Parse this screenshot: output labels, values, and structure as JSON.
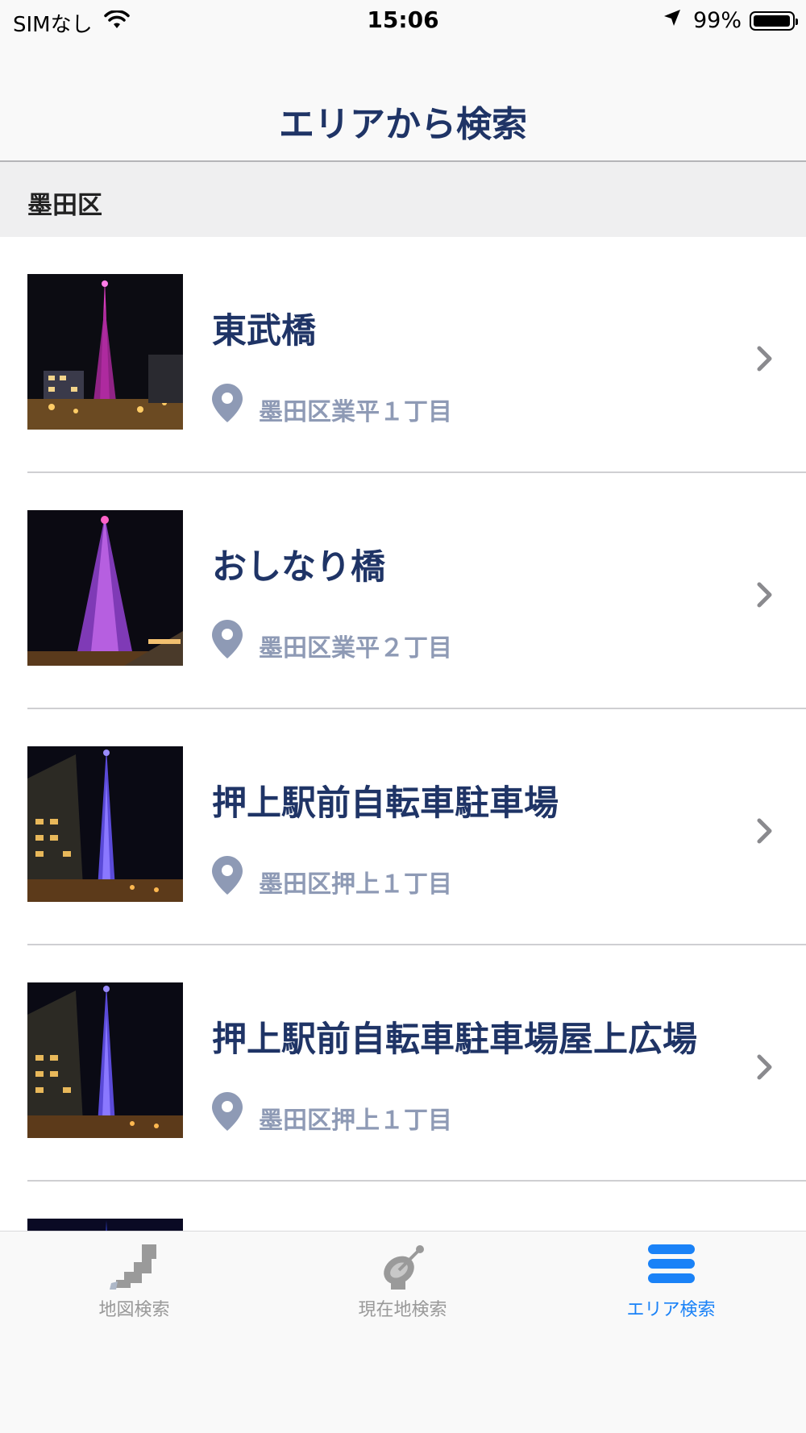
{
  "status": {
    "carrier": "SIMなし",
    "time": "15:06",
    "battery": "99%"
  },
  "nav": {
    "title": "エリアから検索"
  },
  "section": {
    "title": "墨田区"
  },
  "list": {
    "items": [
      {
        "name": "東武橋",
        "address": "墨田区業平１丁目"
      },
      {
        "name": "おしなり橋",
        "address": "墨田区業平２丁目"
      },
      {
        "name": "押上駅前自転車駐車場",
        "address": "墨田区押上１丁目"
      },
      {
        "name": "押上駅前自転車駐車場屋上広場",
        "address": "墨田区押上１丁目"
      }
    ]
  },
  "tabs": [
    {
      "label": "地図検索",
      "icon": "japan-map-icon"
    },
    {
      "label": "現在地検索",
      "icon": "satellite-dish-icon"
    },
    {
      "label": "エリア検索",
      "icon": "list-stack-icon",
      "active": true
    }
  ],
  "colors": {
    "title": "#1f3466",
    "address": "#8e9ab5",
    "tab_active": "#1a82f7",
    "tab_inactive": "#999999"
  }
}
